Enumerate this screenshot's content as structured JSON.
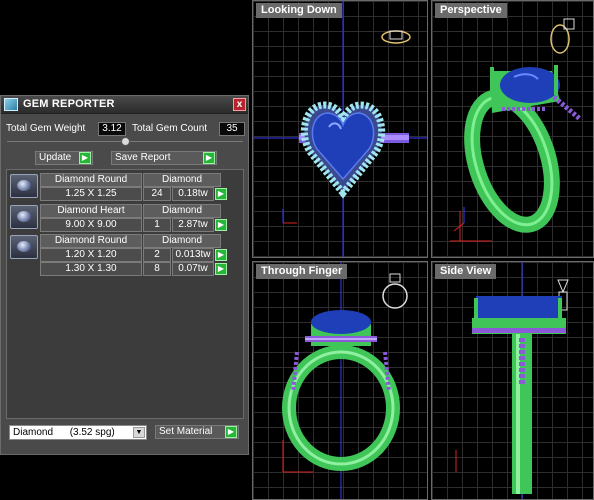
{
  "panel": {
    "title": "GEM REPORTER",
    "close_label": "x",
    "total_weight_label": "Total Gem Weight",
    "total_weight_value": "3.12",
    "total_count_label": "Total Gem Count",
    "total_count_value": "35",
    "update_label": "Update",
    "save_report_label": "Save Report",
    "gems": [
      {
        "name": "Diamond Round",
        "material": "Diamond",
        "rows": [
          {
            "size": "1.25 X 1.25",
            "count": "24",
            "weight": "0.18tw"
          }
        ]
      },
      {
        "name": "Diamond Heart",
        "material": "Diamond",
        "rows": [
          {
            "size": "9.00 X 9.00",
            "count": "1",
            "weight": "2.87tw"
          }
        ]
      },
      {
        "name": "Diamond Round",
        "material": "Diamond",
        "rows": [
          {
            "size": "1.20 X 1.20",
            "count": "2",
            "weight": "0.013tw"
          },
          {
            "size": "1.30 X 1.30",
            "count": "8",
            "weight": "0.07tw"
          }
        ]
      }
    ],
    "material_select": "Diamond      (3.52 spg)",
    "set_material_label": "Set Material"
  },
  "viewports": {
    "top_left": "Looking Down",
    "top_right": "Perspective",
    "bottom_left": "Through Finger",
    "bottom_right": "Side View"
  },
  "colors": {
    "metal": "#44d15a",
    "gem": "#1f3fb8",
    "accent_stones": "#8a5ad8",
    "halo_stones": "#9fe6ee",
    "grid": "#2d2d2d",
    "axis_blue": "#3a3aff",
    "axis_red": "#d22"
  }
}
